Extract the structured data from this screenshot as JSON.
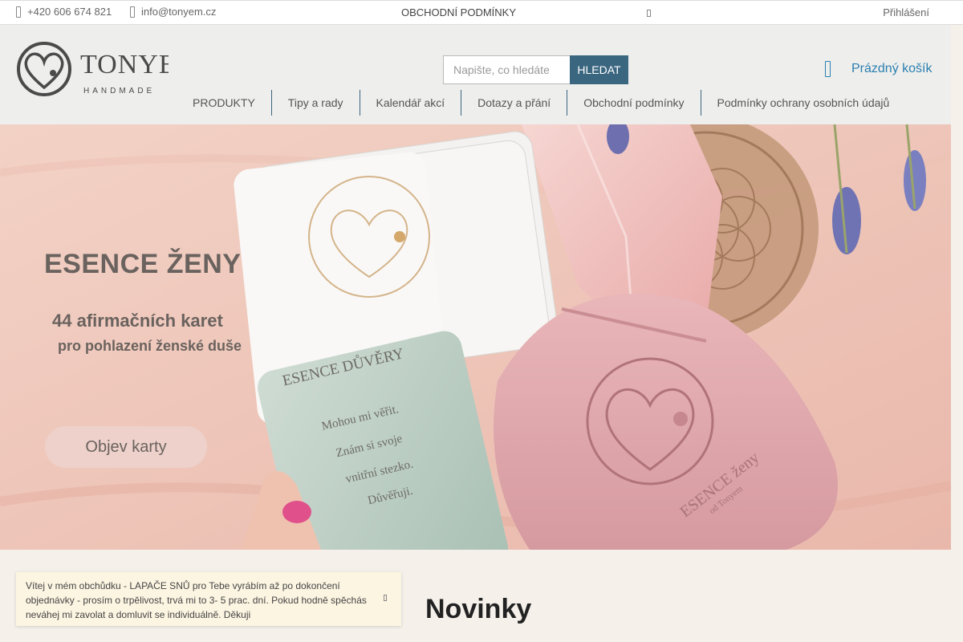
{
  "topbar": {
    "phone": "+420 606 674 821",
    "email": "info@tonyem.cz",
    "terms": "OBCHODNÍ PODMÍNKY",
    "login": "Přihlášení"
  },
  "header": {
    "logo_text": "TONYEM",
    "logo_sub": "HANDMADE",
    "search_placeholder": "Napište, co hledáte",
    "search_button": "HLEDAT",
    "cart_label": "Prázdný košík"
  },
  "nav": {
    "items": [
      {
        "label": "PRODUKTY"
      },
      {
        "label": "Tipy a rady"
      },
      {
        "label": "Kalendář akcí"
      },
      {
        "label": "Dotazy a přání"
      },
      {
        "label": "Obchodní podmínky"
      },
      {
        "label": "Podmínky ochrany osobních údajů"
      }
    ]
  },
  "hero": {
    "title": "ESENCE ŽENY",
    "subtitle1": "44 afirmačních karet",
    "subtitle2": "pro pohlazení ženské duše",
    "cta": "Objev karty",
    "card_title": "ESENCE DŮVĚRY",
    "card_lines": [
      "Mohou mi věřit.",
      "Znám si svoje",
      "vnitřní stezko.",
      "Důvěřuji."
    ],
    "pouch_text": "ESENCE ženy",
    "pouch_sub": "od Tonyem"
  },
  "notice": {
    "text": "Vítej v mém obchůdku - LAPAČE SNŮ pro Tebe vyrábím až po dokončení objednávky - prosím o trpělivost, trvá mi to 3- 5 prac. dní. Pokud hodně spěchás neváhej mi zavolat a domluvit se individuálně. Děkuji"
  },
  "section": {
    "title": "Novinky"
  },
  "colors": {
    "accent": "#3b6680",
    "cart": "#2a7fb0",
    "notice_bg": "#fcf5e2"
  }
}
